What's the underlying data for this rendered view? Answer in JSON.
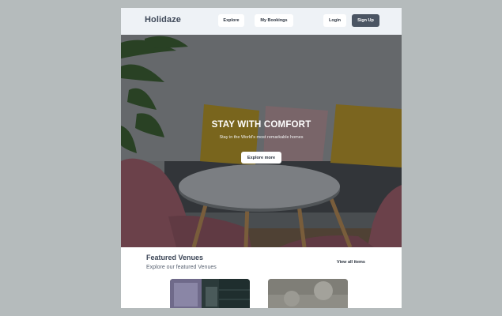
{
  "header": {
    "logo": "Holidaze",
    "nav": {
      "explore": "Explore",
      "my_bookings": "My Bookings"
    },
    "auth": {
      "login": "Login",
      "signup": "Sign Up"
    }
  },
  "hero": {
    "title": "STAY WITH COMFORT",
    "subtitle": "Stay in the World's most remarkable homes",
    "cta": "Explore more"
  },
  "featured": {
    "title": "Featured Venues",
    "subtitle": "Explore our featured Venues",
    "view_all": "View all items"
  },
  "colors": {
    "page_bg": "#b5bbbc",
    "header_bg": "#eef2f6",
    "signup_bg": "#4b5563",
    "text_dark": "#3c4657"
  }
}
